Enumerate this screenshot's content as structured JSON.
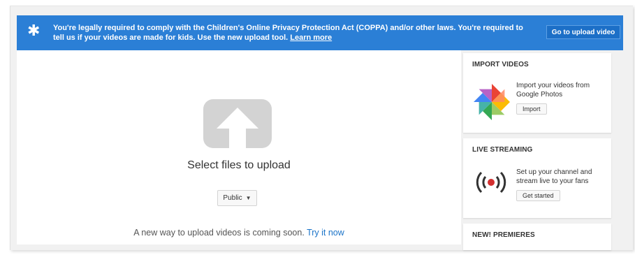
{
  "banner": {
    "icon": "star-icon",
    "text_1": "You're legally required to comply with the Children's Online Privacy Protection Act (COPPA) and/or other laws. You're required to tell us if your videos are made for kids. Use the new upload tool.",
    "learn_more": "Learn more",
    "button_label": "Go to upload video",
    "color": "#2b7fd6"
  },
  "upload": {
    "icon": "upload-arrow-icon",
    "select_label": "Select files to upload",
    "privacy_value": "Public",
    "new_way_text": "A new way to upload videos is coming soon.",
    "try_link": "Try it now"
  },
  "sidebar": {
    "import": {
      "title": "IMPORT VIDEOS",
      "icon": "google-photos-icon",
      "description": "Import your videos from Google Photos",
      "button_label": "Import"
    },
    "live": {
      "title": "LIVE STREAMING",
      "icon": "live-broadcast-icon",
      "description": "Set up your channel and stream live to your fans",
      "button_label": "Get started"
    },
    "premieres": {
      "title": "NEW! PREMIERES"
    }
  }
}
